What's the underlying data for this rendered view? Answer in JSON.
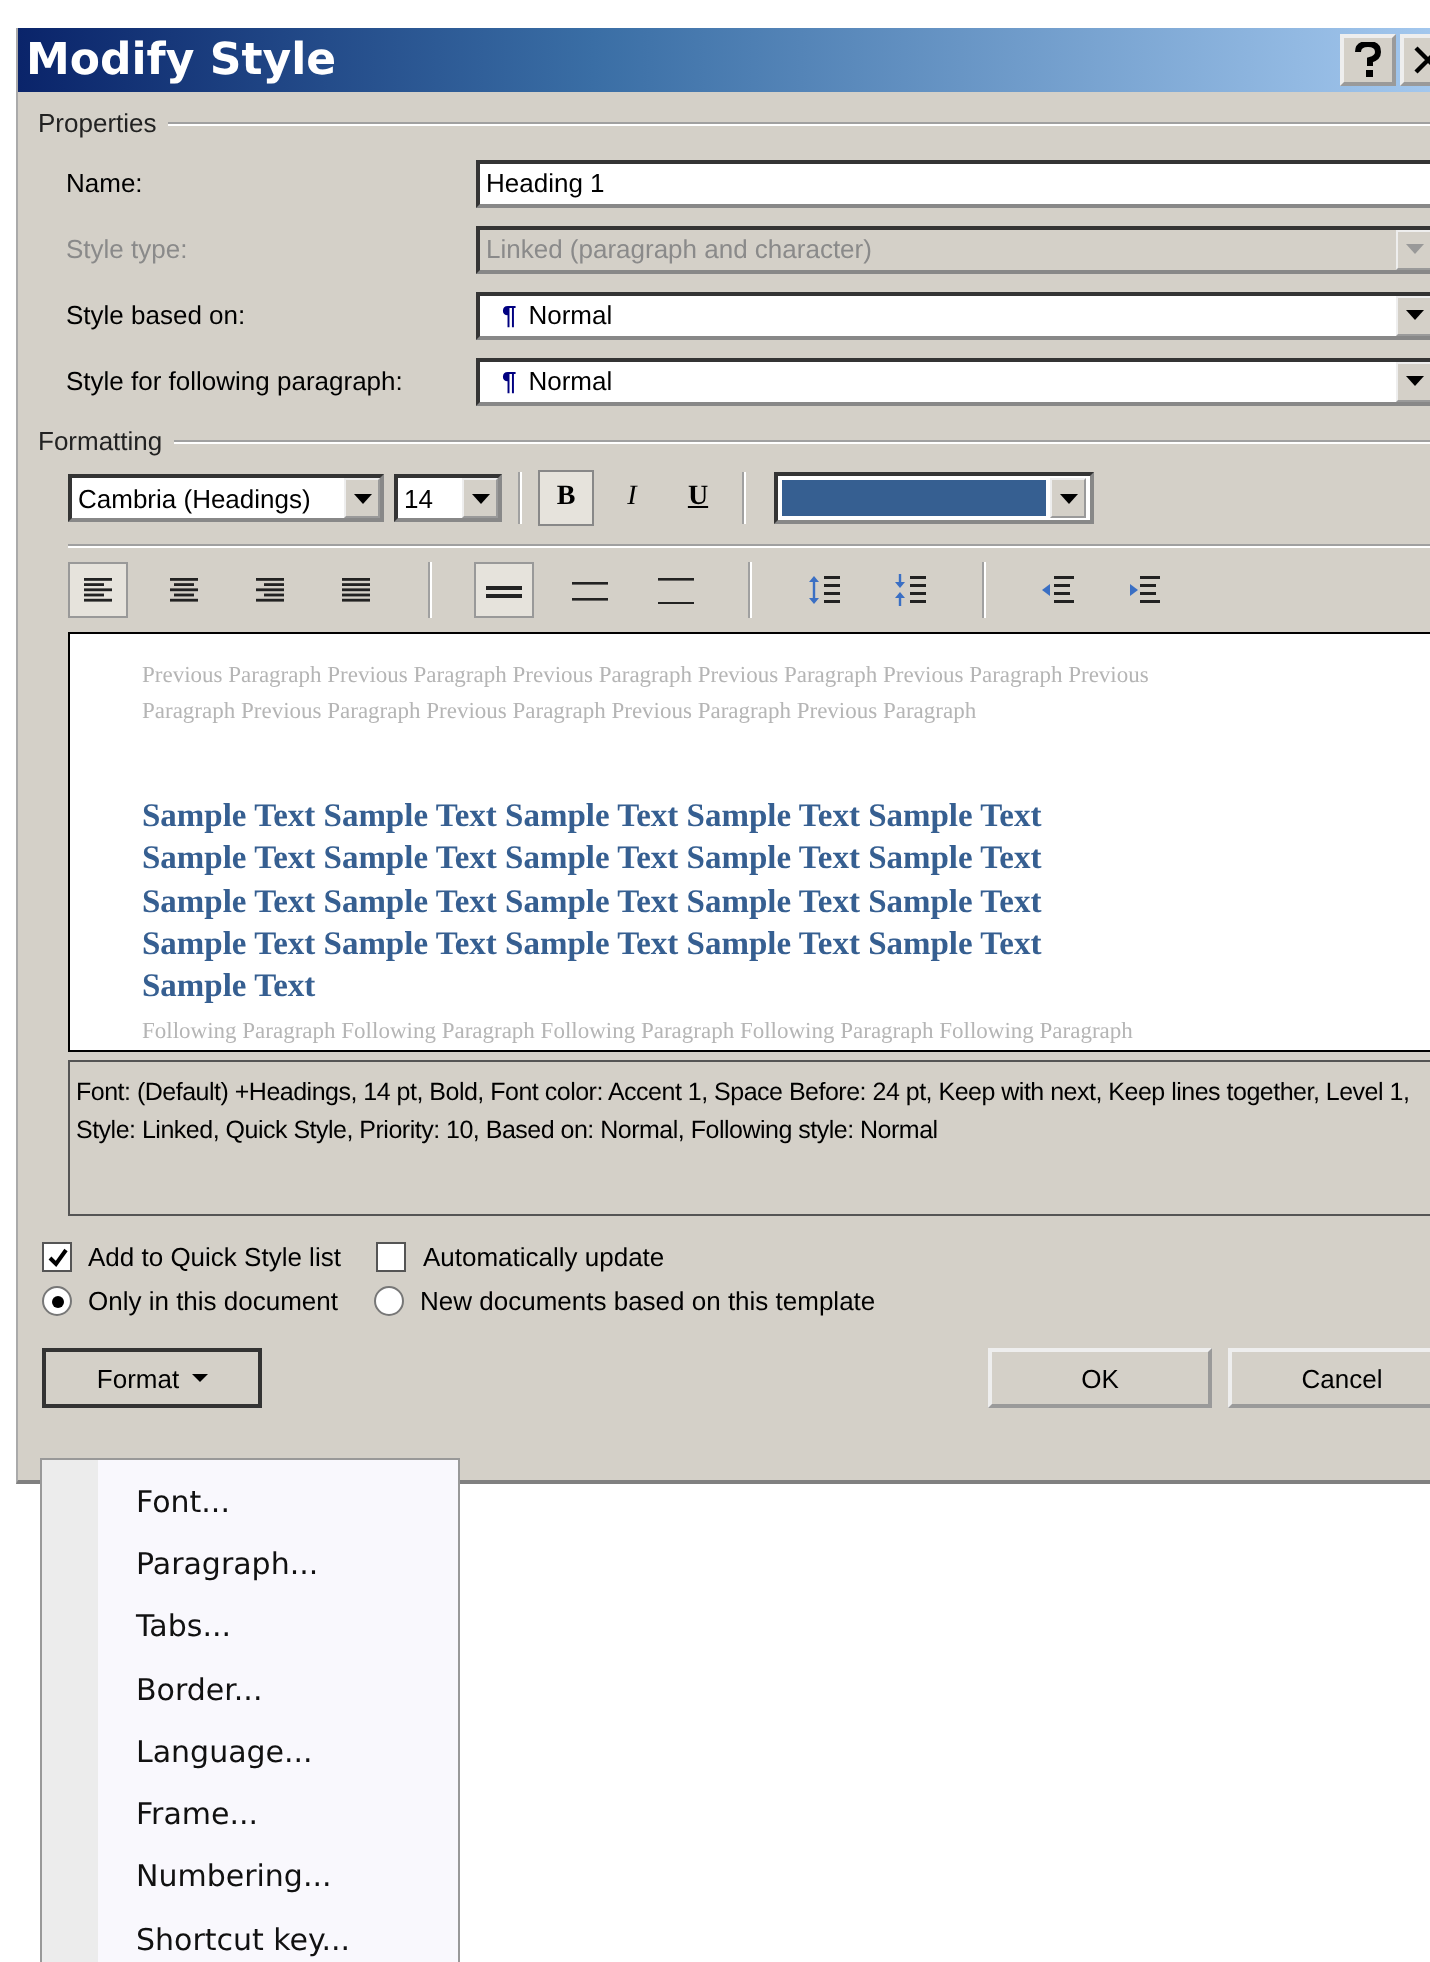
{
  "window": {
    "title": "Modify Style"
  },
  "properties": {
    "legend": "Properties",
    "fields": [
      {
        "label": "Name:",
        "value": "Heading 1",
        "kind": "text",
        "disabled": false
      },
      {
        "label": "Style type:",
        "value": "Linked (paragraph and character)",
        "kind": "dropdown",
        "disabled": true
      },
      {
        "label": "Style based on:",
        "value": "Normal",
        "icon": "¶",
        "kind": "dropdown",
        "disabled": false
      },
      {
        "label": "Style for following paragraph:",
        "value": "Normal",
        "icon": "¶",
        "kind": "dropdown",
        "disabled": false
      }
    ]
  },
  "formatting": {
    "legend": "Formatting",
    "font": "Cambria (Headings)",
    "size": "14",
    "styles": [
      {
        "label": "B",
        "kind": "bold",
        "selected": true
      },
      {
        "label": "I",
        "kind": "italic",
        "selected": false
      },
      {
        "label": "U",
        "kind": "underline",
        "selected": false
      }
    ],
    "alignment": [
      {
        "kind": "left",
        "selected": true
      },
      {
        "kind": "center",
        "selected": false
      },
      {
        "kind": "right",
        "selected": false
      },
      {
        "kind": "justify",
        "selected": false
      }
    ],
    "line_spacing": [
      {
        "kind": "single",
        "selected": true
      },
      {
        "kind": "one-half",
        "selected": false
      },
      {
        "kind": "double",
        "selected": false
      }
    ]
  },
  "preview": {
    "previous": "Previous Paragraph Previous Paragraph Previous Paragraph Previous Paragraph Previous Paragraph Previous Paragraph Previous Paragraph Previous Paragraph Previous Paragraph Previous Paragraph",
    "sample": "Sample Text Sample Text Sample Text Sample Text Sample Text Sample Text Sample Text Sample Text Sample Text Sample Text Sample Text Sample Text Sample Text Sample Text Sample Text Sample Text Sample Text Sample Text Sample Text Sample Text Sample Text",
    "following": "Following Paragraph Following Paragraph Following Paragraph Following Paragraph Following Paragraph"
  },
  "description": "Font: (Default) +Headings, 14 pt, Bold, Font color: Accent 1, Space Before:  24 pt, Keep with next, Keep lines together, Level 1, Style: Linked, Quick Style, Priority: 10, Based on: Normal, Following style: Normal",
  "checkboxes": [
    {
      "label": "Add to Quick Style list",
      "checked": true
    },
    {
      "label": "Automatically update",
      "checked": false
    }
  ],
  "radios": [
    {
      "label": "Only in this document",
      "selected": true
    },
    {
      "label": "New documents based on this template",
      "selected": false
    }
  ],
  "buttons": [
    {
      "label": "Format",
      "kind": "menu"
    },
    {
      "label": "OK",
      "kind": "ok"
    },
    {
      "label": "Cancel",
      "kind": "cancel"
    }
  ],
  "format_menu": [
    "Font...",
    "Paragraph...",
    "Tabs...",
    "Border...",
    "Language...",
    "Frame...",
    "Numbering...",
    "Shortcut key..."
  ]
}
